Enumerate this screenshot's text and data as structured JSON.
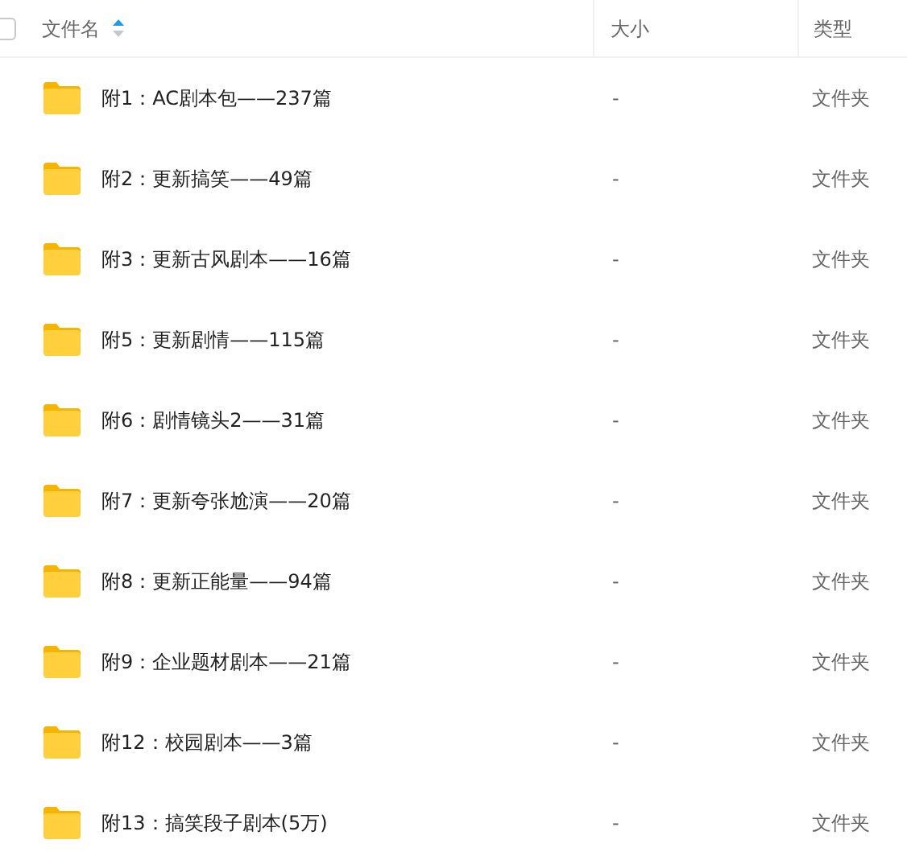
{
  "header": {
    "select_all": {
      "checked": false
    },
    "columns": [
      {
        "label": "文件名",
        "sort_ascending": true
      },
      {
        "label": "大小"
      },
      {
        "label": "类型"
      }
    ]
  },
  "rows": [
    {
      "name": "附1：AC剧本包——237篇",
      "size": "-",
      "type": "文件夹"
    },
    {
      "name": "附2：更新搞笑——49篇",
      "size": "-",
      "type": "文件夹"
    },
    {
      "name": "附3：更新古风剧本——16篇",
      "size": "-",
      "type": "文件夹"
    },
    {
      "name": "附5：更新剧情——115篇",
      "size": "-",
      "type": "文件夹"
    },
    {
      "name": "附6：剧情镜头2——31篇",
      "size": "-",
      "type": "文件夹"
    },
    {
      "name": "附7：更新夸张尬演——20篇",
      "size": "-",
      "type": "文件夹"
    },
    {
      "name": "附8：更新正能量——94篇",
      "size": "-",
      "type": "文件夹"
    },
    {
      "name": "附9：企业题材剧本——21篇",
      "size": "-",
      "type": "文件夹"
    },
    {
      "name": "附12：校园剧本——3篇",
      "size": "-",
      "type": "文件夹"
    },
    {
      "name": "附13：搞笑段子剧本(5万)",
      "size": "-",
      "type": "文件夹"
    }
  ]
}
